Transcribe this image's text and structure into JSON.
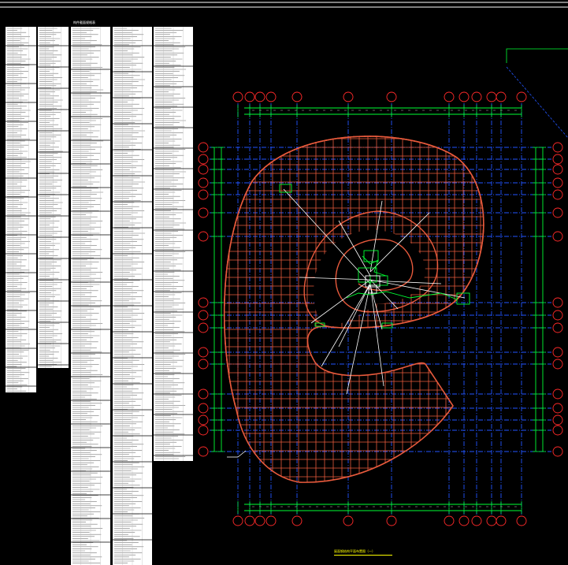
{
  "drawing": {
    "caption": "屋面钢结构平面布置图（一）",
    "table_title": "构件截面规格表",
    "colors": {
      "background": "#000000",
      "frame": "#ffffff",
      "grid_axis_lines": "#2255ff",
      "grid_bubbles": "#ff2a2a",
      "dimension_lines": "#00ff33",
      "roof_members": "#e85a3c",
      "leader_lines": "#ffffff",
      "caption_text": "#ffff00",
      "table_cells": "#ffffff",
      "table_text": "#000000"
    }
  }
}
